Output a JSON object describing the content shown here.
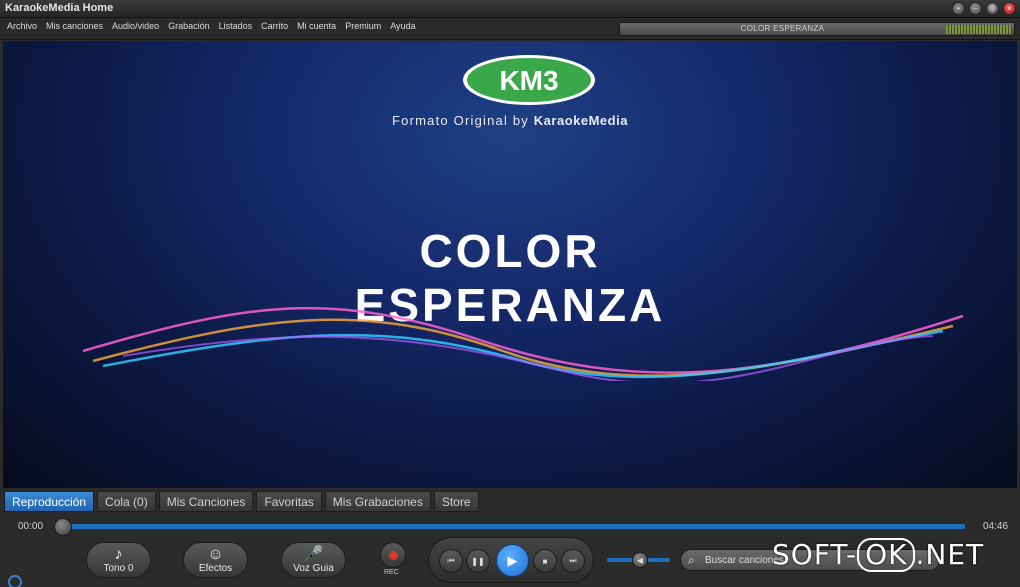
{
  "window": {
    "title": "KaraokeMedia Home"
  },
  "menu": [
    "Archivo",
    "Mis canciones",
    "Audio/video",
    "Grabación",
    "Listados",
    "Carrito",
    "Mi cuenta",
    "Premium",
    "Ayuda"
  ],
  "now_playing": "COLOR ESPERANZA",
  "video": {
    "logo_text": "KM3",
    "tagline_prefix": "Formato Original by ",
    "tagline_brand": "KaraokeMedia",
    "song_line1": "COLOR",
    "song_line2": "ESPERANZA"
  },
  "tabs": [
    "Reproducción",
    "Cola (0)",
    "Mis Canciones",
    "Favoritas",
    "Mis Grabaciones",
    "Store"
  ],
  "progress": {
    "elapsed": "00:00",
    "total": "04:46",
    "fraction": 0.0
  },
  "controls": {
    "tono": "Tono 0",
    "efectos": "Efectos",
    "voz": "Voz Guia",
    "rec": "REC"
  },
  "search": {
    "placeholder": "Buscar canciones"
  },
  "watermark": {
    "part1": "SOFT-",
    "part2": "OK",
    "part3": ".NET"
  },
  "colors": {
    "accent": "#1f6fc0",
    "logo_green": "#3aa84a",
    "record": "#d83a2a"
  }
}
